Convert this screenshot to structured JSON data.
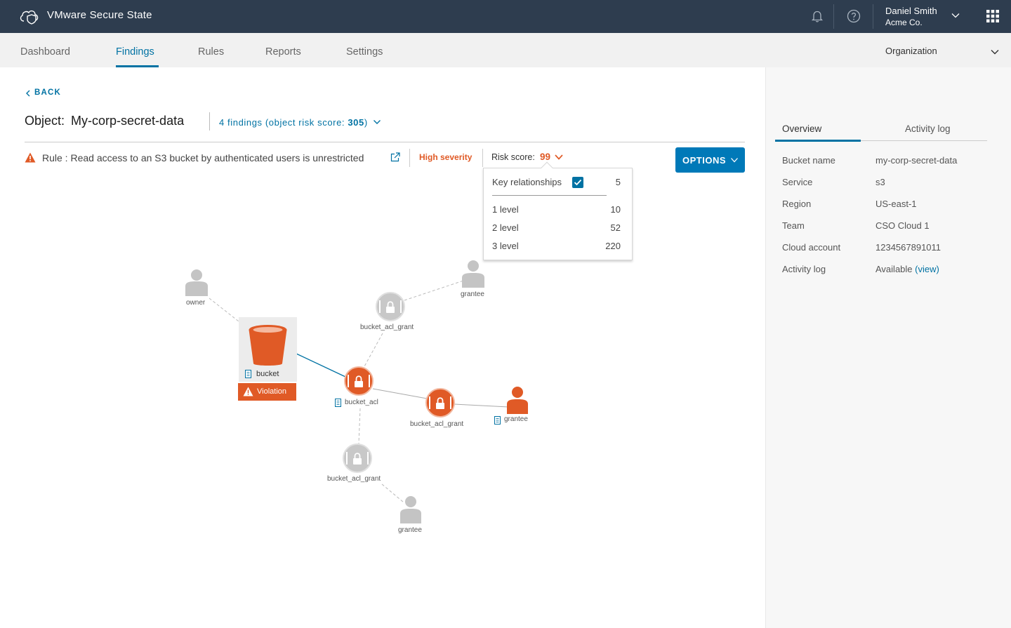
{
  "app": {
    "title": "VMware Secure State"
  },
  "user": {
    "name": "Daniel Smith",
    "org": "Acme Co."
  },
  "nav": {
    "tabs": [
      {
        "label": "Dashboard"
      },
      {
        "label": "Findings"
      },
      {
        "label": "Rules"
      },
      {
        "label": "Reports"
      },
      {
        "label": "Settings"
      }
    ],
    "active_tab": "Findings",
    "org_selector": "Organization"
  },
  "back": {
    "label": "BACK"
  },
  "object": {
    "prefix": "Object:",
    "name": "My-corp-secret-data",
    "findings_text": "4 findings (object risk score: ",
    "findings_score": "305",
    "findings_close": ")"
  },
  "rule": {
    "text": "Rule : Read access to an S3 bucket by authenticated users is unrestricted",
    "severity": "High severity",
    "risk_label": "Risk score:",
    "risk_value": "99"
  },
  "options": {
    "label": "OPTIONS"
  },
  "dropdown": {
    "key_label": "Key relationships",
    "key_checked": true,
    "key_count": "5",
    "levels": [
      {
        "label": "1 level",
        "count": "10"
      },
      {
        "label": "2 level",
        "count": "52"
      },
      {
        "label": "3 level",
        "count": "220"
      }
    ]
  },
  "graph": {
    "nodes": {
      "owner": "owner",
      "grantee_top": "grantee",
      "grant_top": "bucket_acl_grant",
      "bucket": "bucket",
      "violation": "Violation",
      "acl": "bucket_acl",
      "grant_mid": "bucket_acl_grant",
      "grantee_mid": "grantee",
      "grant_bottom": "bucket_acl_grant",
      "grantee_bottom": "grantee"
    }
  },
  "panel": {
    "tabs": [
      {
        "label": "Overview"
      },
      {
        "label": "Activity log"
      }
    ],
    "properties": [
      {
        "label": "Bucket name",
        "value": "my-corp-secret-data"
      },
      {
        "label": "Service",
        "value": "s3"
      },
      {
        "label": "Region",
        "value": "US-east-1"
      },
      {
        "label": "Team",
        "value": "CSO Cloud 1"
      },
      {
        "label": "Cloud account",
        "value": "1234567891011"
      },
      {
        "label": "Activity log",
        "value": "Available",
        "link": "(view)"
      }
    ]
  },
  "colors": {
    "header_bg": "#2e3d4f",
    "accent": "#0072a3",
    "danger": "#e05a26",
    "node_gray": "#c4c4c4"
  }
}
